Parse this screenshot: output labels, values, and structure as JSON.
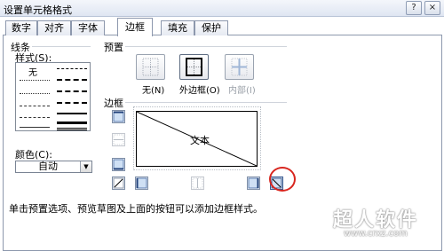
{
  "window": {
    "title": "设置单元格格式",
    "help_glyph": "?",
    "close_glyph": "×"
  },
  "tabs": [
    "数字",
    "对齐",
    "字体",
    "边框",
    "填充",
    "保护"
  ],
  "active_tab": "边框",
  "line": {
    "group_label": "线条",
    "style_label": "样式(S):",
    "none_label": "无",
    "color_label": "颜色(C):",
    "color_value": "自动"
  },
  "presets": {
    "group_label": "预置",
    "items": [
      {
        "label": "无(N)",
        "enabled": true
      },
      {
        "label": "外边框(O)",
        "enabled": true
      },
      {
        "label": "内部(I)",
        "enabled": false
      }
    ]
  },
  "border": {
    "group_label": "边框",
    "preview_text": "文本"
  },
  "hint": "单击预置选项、预览草图及上面的按钮可以添加边框样式。",
  "watermark": {
    "brand": "超人软件",
    "url": "www.crxz.com"
  },
  "colors": {
    "accent": "#3a6fc4",
    "highlight_circle": "#d8261f"
  }
}
